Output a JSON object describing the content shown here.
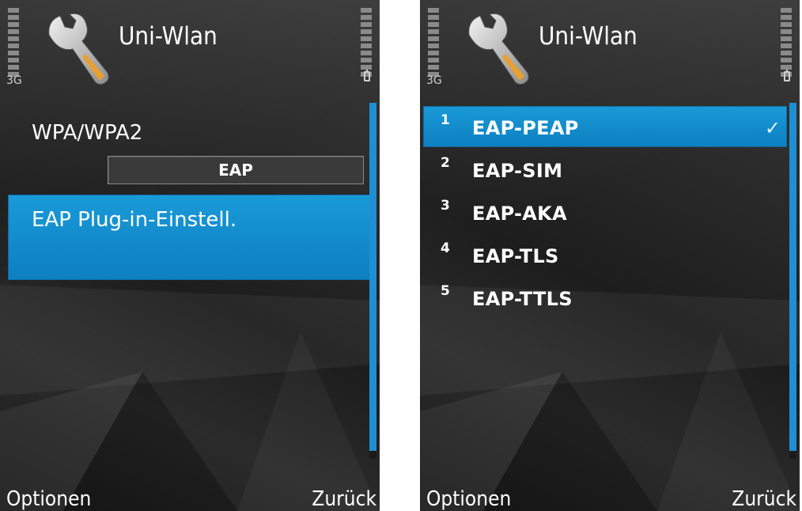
{
  "app": {
    "title": "Uni-Wlan"
  },
  "status": {
    "network": "3G"
  },
  "left_screen": {
    "security_mode": "WPA/WPA2",
    "eap_field_value": "EAP",
    "selected_item": "EAP Plug-in-Einstell."
  },
  "right_screen": {
    "items": [
      {
        "number": "1",
        "label": "EAP-PEAP",
        "selected": true,
        "check": "✓"
      },
      {
        "number": "2",
        "label": "EAP-SIM"
      },
      {
        "number": "3",
        "label": "EAP-AKA"
      },
      {
        "number": "4",
        "label": "EAP-TLS"
      },
      {
        "number": "5",
        "label": "EAP-TTLS"
      }
    ]
  },
  "softkeys": {
    "left": "Optionen",
    "right": "Zurück"
  },
  "colors": {
    "accent": "#1a9ad8",
    "background": "#2a2a2a",
    "text": "#ffffff"
  },
  "icons": {
    "app": "wrench-icon"
  }
}
